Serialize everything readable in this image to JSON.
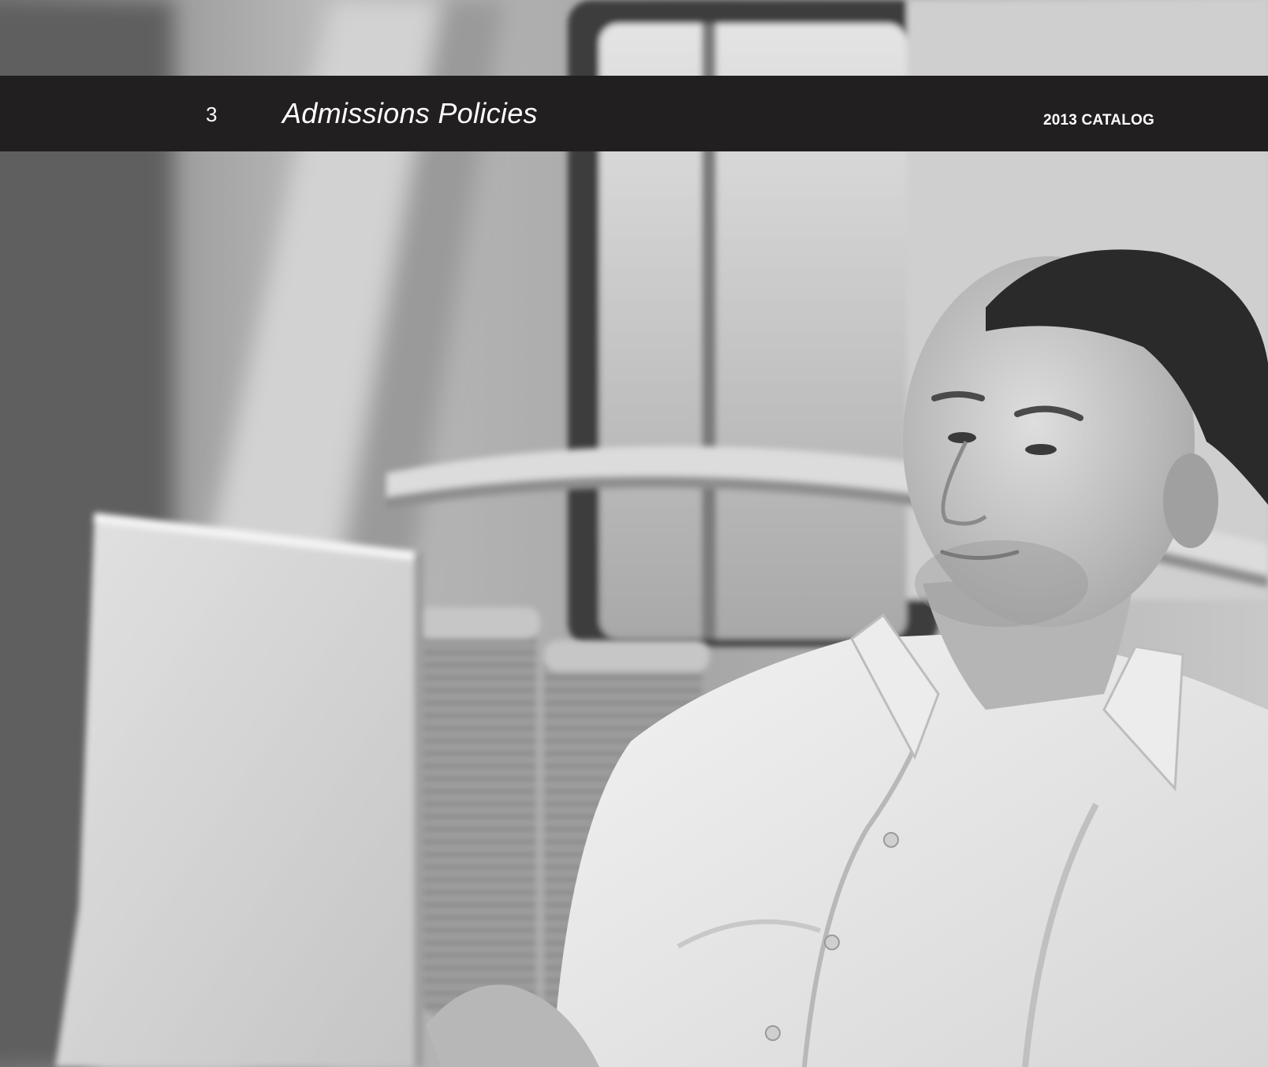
{
  "header": {
    "chapter_number": "3",
    "chapter_title": "Admissions Policies",
    "catalog_label": "2013 CATALOG"
  },
  "colors": {
    "header_band": "#221f20",
    "header_text": "#ffffff"
  }
}
